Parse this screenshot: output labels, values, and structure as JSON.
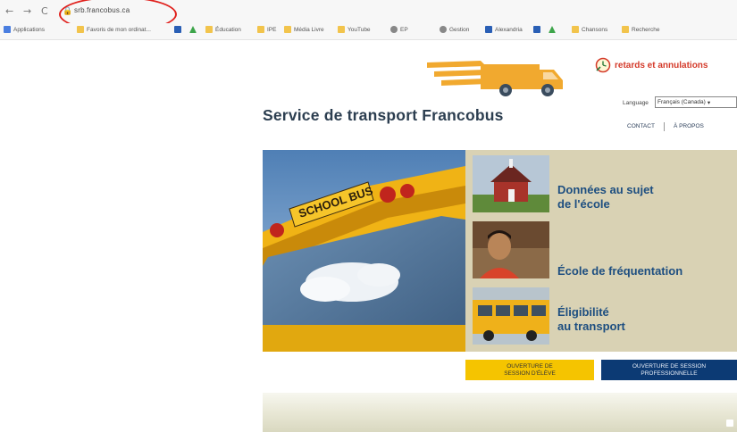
{
  "browser": {
    "nav": [
      "←",
      "→",
      "C"
    ],
    "url": "srb.francobus.ca",
    "bookmarks": [
      {
        "label": "Applications",
        "icon": "apps-grid-icon"
      },
      {
        "label": "Favoris de mon ordinat...",
        "icon": "folder-icon"
      },
      {
        "label": "",
        "icon": "blue-square-icon"
      },
      {
        "label": "",
        "icon": "drive-icon"
      },
      {
        "label": "Éducation",
        "icon": "folder-icon"
      },
      {
        "label": "IPE",
        "icon": "folder-icon"
      },
      {
        "label": "Média Livre",
        "icon": "folder-icon"
      },
      {
        "label": "YouTube",
        "icon": "folder-icon"
      },
      {
        "label": "EP",
        "icon": "globe-icon"
      },
      {
        "label": "Gestion",
        "icon": "globe-icon"
      },
      {
        "label": "Alexandria",
        "icon": "blue-square-icon"
      },
      {
        "label": "",
        "icon": "blue-square-icon"
      },
      {
        "label": "",
        "icon": "drive-icon"
      },
      {
        "label": "Chansons",
        "icon": "folder-icon"
      },
      {
        "label": "Recherche",
        "icon": "folder-icon"
      }
    ]
  },
  "page": {
    "title": "Service de transport Francobus",
    "delays_link": "retards et annulations",
    "language_label": "Language",
    "language_value": "Français (Canada)",
    "topnav": [
      "CONTACT",
      "À PROPOS"
    ],
    "hero_bus_text": "SCHOOL BUS",
    "links": [
      {
        "line1": "Données au sujet",
        "line2": "de l'école"
      },
      {
        "line1": "École de fréquentation",
        "line2": ""
      },
      {
        "line1": "Éligibilité",
        "line2": "au transport"
      }
    ],
    "student_button": {
      "line1": "OUVERTURE DE",
      "line2": "SESSION D'ÉLÈVE"
    },
    "pro_button": {
      "line1": "OUVERTURE DE SESSION",
      "line2": "PROFESSIONNELLE"
    }
  },
  "colors": {
    "accent_yellow": "#f5c400",
    "navy": "#0c3a74",
    "link_blue": "#1d4e80",
    "annotation_red": "#e0201c",
    "panel_tan": "#d9d2b4"
  }
}
